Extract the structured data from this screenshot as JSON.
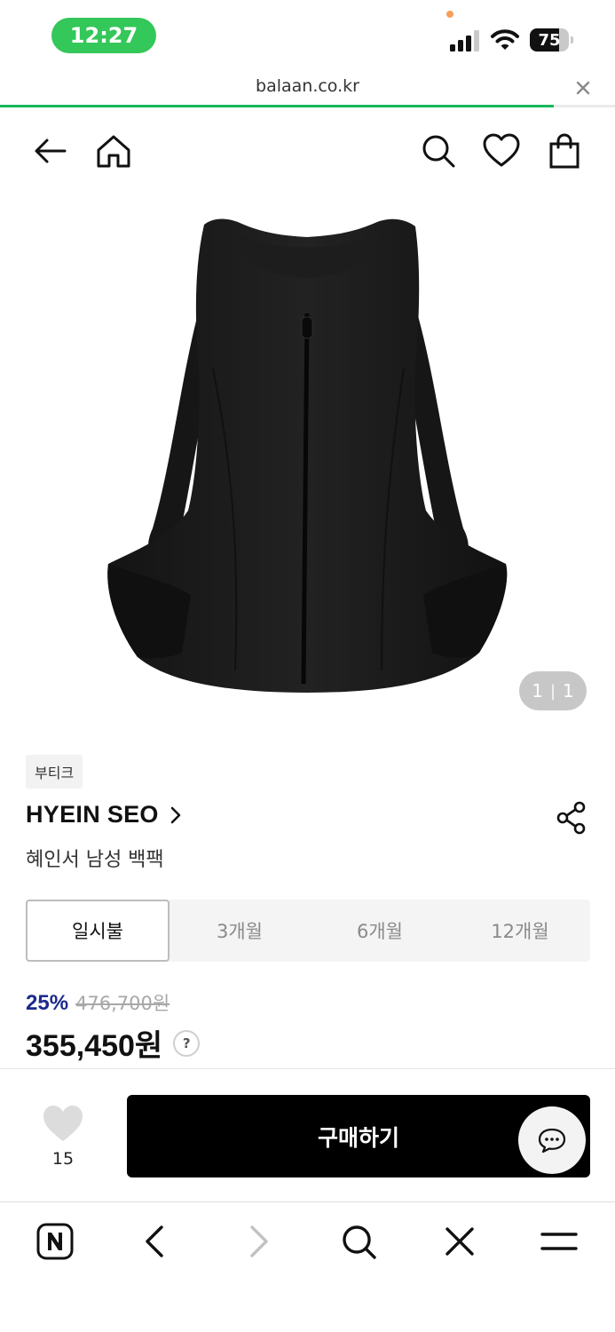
{
  "status_bar": {
    "time": "12:27",
    "battery_level": "75",
    "battery_fraction": 0.75
  },
  "url_bar": {
    "domain": "balaan.co.kr",
    "load_progress": 0.9
  },
  "header": {
    "icons": [
      "back-arrow-icon",
      "home-icon",
      "search-icon",
      "heart-icon",
      "shopping-bag-icon"
    ]
  },
  "product": {
    "image_counter_current": "1",
    "image_counter_total": "1",
    "tag": "부티크",
    "brand": "HYEIN SEO",
    "name": "혜인서 남성 백팩"
  },
  "installment_tabs": [
    {
      "label": "일시불",
      "active": true
    },
    {
      "label": "3개월",
      "active": false
    },
    {
      "label": "6개월",
      "active": false
    },
    {
      "label": "12개월",
      "active": false
    }
  ],
  "price": {
    "discount": "25%",
    "original": "476,700원",
    "final": "355,450원",
    "help_label": "?"
  },
  "purchase_bar": {
    "like_count": "15",
    "buy_label": "구매하기"
  },
  "colors": {
    "status_pill": "#34c759",
    "progress": "#17b85a",
    "discount": "#1b2a8c",
    "buy_button": "#000000"
  },
  "toolbar": {
    "icons": [
      "naver-icon",
      "back-chevron-icon",
      "forward-chevron-icon",
      "search-icon",
      "close-icon",
      "menu-icon"
    ]
  }
}
